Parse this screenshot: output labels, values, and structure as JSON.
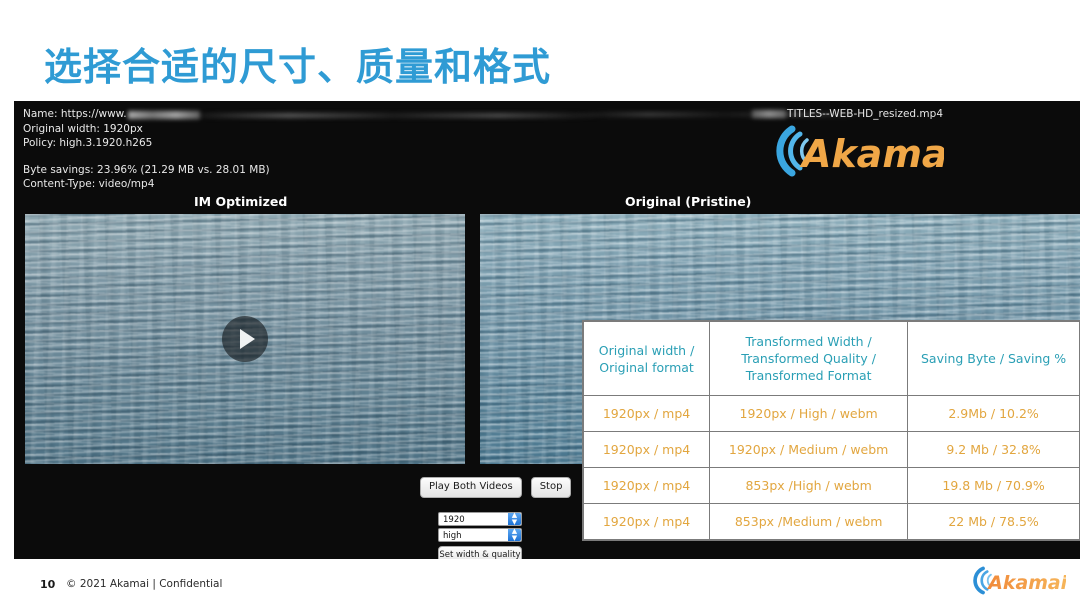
{
  "slide": {
    "title": "选择合适的尺寸、质量和格式",
    "title_color": "#2f9bd4"
  },
  "screenshot": {
    "info_panel": {
      "name_label": "Name: https://www.",
      "original_width": "Original width: 1920px",
      "policy": "Policy: high.3.1920.h265",
      "byte_savings": "Byte savings: 23.96% (21.29 MB vs. 28.01 MB)",
      "content_type": "Content-Type: video/mp4"
    },
    "filename": "TITLES--WEB-HD_resized.mp4",
    "logo_text": "Akamai",
    "video_left_heading": "IM Optimized",
    "video_right_heading": "Original (Pristine)",
    "controls": {
      "play_both": "Play Both Videos",
      "stop": "Stop",
      "width_select_value": "1920",
      "quality_select_value": "high",
      "set_button": "Set width & quality"
    }
  },
  "table": {
    "headers": [
      "Original width / Original format",
      "Transformed Width / Transformed Quality / Transformed Format",
      "Saving Byte / Saving %"
    ],
    "header_lines": {
      "c1l1": "Original width /",
      "c1l2": "Original format",
      "c2l1": "Transformed Width /",
      "c2l2": "Transformed Quality /",
      "c2l3": "Transformed Format",
      "c3l1": "Saving Byte / Saving %"
    },
    "header_color": "#2a9fb5",
    "body_color": "#e2a63f",
    "rows": [
      {
        "original": "1920px / mp4",
        "transformed": "1920px / High / webm",
        "saving": "2.9Mb / 10.2%"
      },
      {
        "original": "1920px / mp4",
        "transformed": "1920px / Medium / webm",
        "saving": "9.2 Mb / 32.8%"
      },
      {
        "original": "1920px / mp4",
        "transformed": "853px /High / webm",
        "saving": "19.8 Mb / 70.9%"
      },
      {
        "original": "1920px / mp4",
        "transformed": "853px /Medium / webm",
        "saving": "22 Mb / 78.5%"
      }
    ]
  },
  "footer": {
    "page_number": "10",
    "copyright": "© 2021 Akamai | Confidential",
    "logo_text": "Akamai"
  }
}
